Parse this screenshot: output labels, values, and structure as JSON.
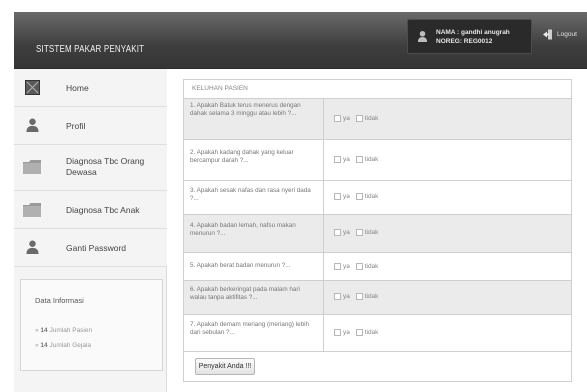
{
  "header": {
    "app_title": "SITSTEM PAKAR PENYAKIT",
    "user_name": "NAMA : gandhi anugrah",
    "user_noreg": "NOREG: REG0012",
    "logout_label": "Logout"
  },
  "sidebar": {
    "items": [
      {
        "label": "Home",
        "icon": "home-icon"
      },
      {
        "label": "Profil",
        "icon": "user-icon"
      },
      {
        "label": "Diagnosa Tbc Orang Dewasa",
        "icon": "folder-icon"
      },
      {
        "label": "Diagnosa Tbc Anak",
        "icon": "folder-icon"
      },
      {
        "label": "Ganti Password",
        "icon": "user-icon"
      }
    ],
    "info": {
      "title": "Data Informasi",
      "pasien_count": "14",
      "pasien_label": "Jumlah Pasien",
      "gejala_count": "14",
      "gejala_label": "Jumlah Gejala"
    }
  },
  "main": {
    "section_title": "KELUHAN PASIEN",
    "option_yes": "ya",
    "option_no": "tidak",
    "questions": [
      "1. Apakah Batuk terus menerus dengan dahak selama 3 minggu atau lebih ?...",
      "2. Apakah kadang dahak yang keluar bercampur darah ?...",
      "3. Apakah sesak nafas dan rasa nyeri dada ?...",
      "4. Apakah badan lemah, nafsu makan menurun ?...",
      "5. Apakah berat badan menurun ?...",
      "6. Apakah berkeringat pada malam hari walau tanpa aktifitas ?...",
      "7. Apakah demam meriang (meriang) lebih dari sebulan ?..."
    ],
    "submit_label": "Penyakit Anda !!!"
  }
}
